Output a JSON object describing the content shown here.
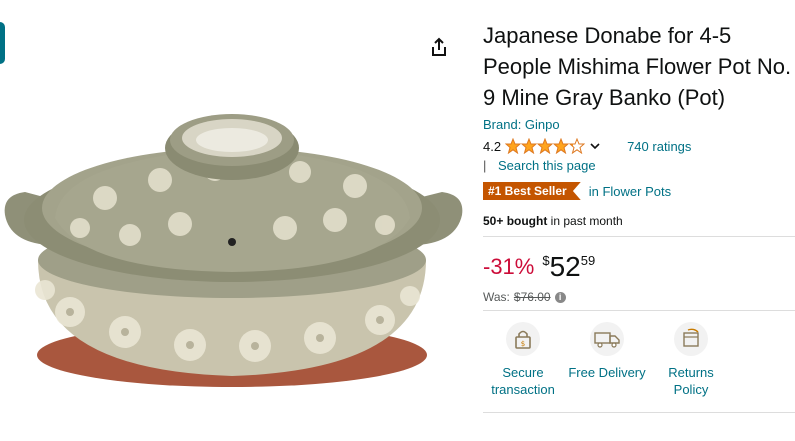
{
  "product": {
    "title": "Japanese Donabe for 4-5 People Mishima Flower Pot No. 9 Mine Gray Banko (Pot)",
    "brand": "Brand: Ginpo",
    "rating": "4.2",
    "stars_filled": 4.2,
    "ratings_count": "740 ratings",
    "search_sep": "|",
    "search_page": "Search this page",
    "badge": "#1 Best Seller",
    "badge_category": "in Flower Pots",
    "bought_bold": "50+ bought",
    "bought_rest": " in past month",
    "discount": "-31%",
    "currency": "$",
    "price_whole": "52",
    "price_fraction": "59",
    "was_label": "Was:",
    "was_price": "$76.00"
  },
  "trust": [
    {
      "line1": "Secure",
      "line2": "transaction",
      "icon": "lock-icon"
    },
    {
      "line1": "Free Delivery",
      "line2": "",
      "icon": "truck-icon"
    },
    {
      "line1": "Returns",
      "line2": "Policy",
      "icon": "return-icon"
    }
  ],
  "colors": {
    "link": "#007185",
    "star": "#ffa41c",
    "deal": "#cc0c39",
    "badge": "#c45500"
  }
}
